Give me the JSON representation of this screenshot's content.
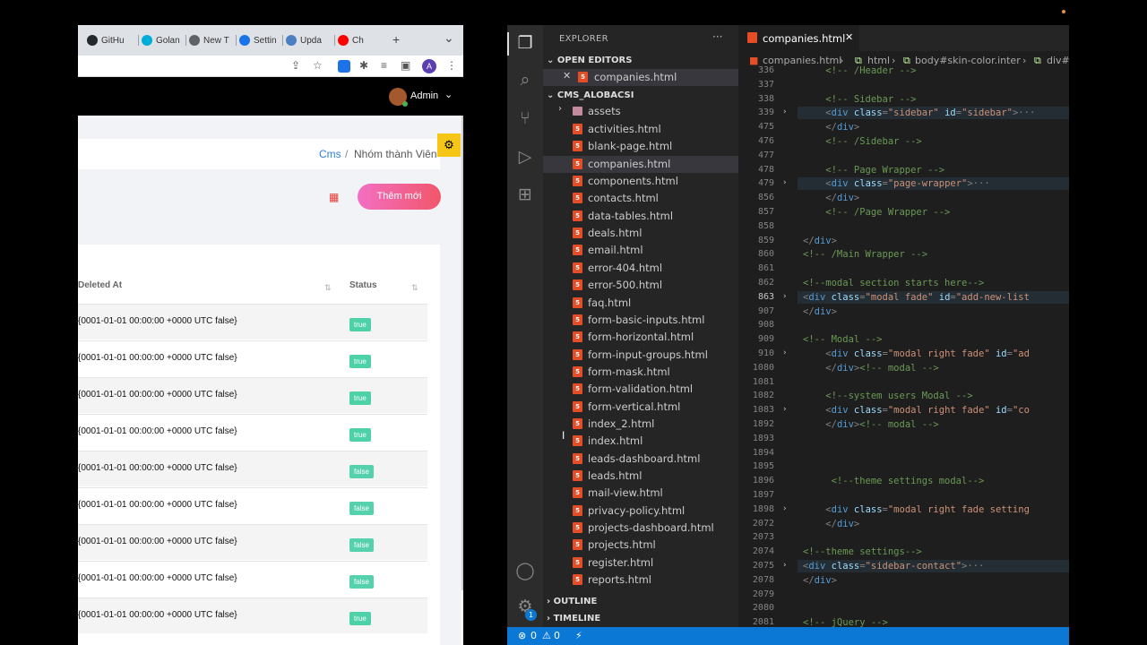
{
  "browser": {
    "tabs": [
      {
        "label": "GitHu",
        "color": "#24292e"
      },
      {
        "label": "Golan",
        "color": "#00add8"
      },
      {
        "label": "New T",
        "color": "#5f6368"
      },
      {
        "label": "Settin",
        "color": "#1a73e8"
      },
      {
        "label": "Upda",
        "color": "#4a7fc1"
      },
      {
        "label": "Ch",
        "color": "#ff0000"
      }
    ],
    "new_tab": "+",
    "tab_menu": "⌄",
    "profile_initial": "A"
  },
  "app": {
    "user_name": "Admin",
    "breadcrumb": {
      "root": "Cms",
      "sep": "/",
      "current": "Nhóm thành Viên"
    },
    "add_button": "Thêm mới",
    "columns": {
      "deleted_at": "Deleted At",
      "status": "Status"
    },
    "rows": [
      {
        "deleted_at": "{0001-01-01 00:00:00 +0000 UTC false}",
        "status": "true"
      },
      {
        "deleted_at": "{0001-01-01 00:00:00 +0000 UTC false}",
        "status": "true"
      },
      {
        "deleted_at": "{0001-01-01 00:00:00 +0000 UTC false}",
        "status": "true"
      },
      {
        "deleted_at": "{0001-01-01 00:00:00 +0000 UTC false}",
        "status": "true"
      },
      {
        "deleted_at": "{0001-01-01 00:00:00 +0000 UTC false}",
        "status": "false"
      },
      {
        "deleted_at": "{0001-01-01 00:00:00 +0000 UTC false}",
        "status": "false"
      },
      {
        "deleted_at": "{0001-01-01 00:00:00 +0000 UTC false}",
        "status": "false"
      },
      {
        "deleted_at": "{0001-01-01 00:00:00 +0000 UTC false}",
        "status": "false"
      },
      {
        "deleted_at": "{0001-01-01 00:00:00 +0000 UTC false}",
        "status": "true"
      }
    ]
  },
  "vscode": {
    "explorer_title": "EXPLORER",
    "explorer_more": "···",
    "open_editors": "OPEN EDITORS",
    "open_file": "companies.html",
    "project": "CMS_ALOBACSI",
    "folder": "assets",
    "files": [
      "activities.html",
      "blank-page.html",
      "companies.html",
      "components.html",
      "contacts.html",
      "data-tables.html",
      "deals.html",
      "email.html",
      "error-404.html",
      "error-500.html",
      "faq.html",
      "form-basic-inputs.html",
      "form-horizontal.html",
      "form-input-groups.html",
      "form-mask.html",
      "form-validation.html",
      "form-vertical.html",
      "index_2.html",
      "index.html",
      "leads-dashboard.html",
      "leads.html",
      "mail-view.html",
      "privacy-policy.html",
      "projects-dashboard.html",
      "projects.html",
      "register.html",
      "reports.html"
    ],
    "selected_file": "companies.html",
    "outline": "OUTLINE",
    "timeline": "TIMELINE",
    "active_tab": "companies.html",
    "breadcrumbs": [
      "companies.html",
      "html",
      "body#skin-color.inter",
      "div#"
    ],
    "accounts_badge": "1",
    "status": {
      "errors": "0",
      "warnings": "0"
    },
    "lines": [
      {
        "n": "336",
        "fold": false,
        "hl": false,
        "html": "<span class='c-cm'>    &lt;!-- /Header --&gt;</span>"
      },
      {
        "n": "337",
        "fold": false,
        "hl": false,
        "html": ""
      },
      {
        "n": "338",
        "fold": false,
        "hl": false,
        "html": "<span class='c-cm'>    &lt;!-- Sidebar --&gt;</span>"
      },
      {
        "n": "339",
        "fold": true,
        "hl": true,
        "html": "    <span class='c-pl'>&lt;</span><span class='c-tag'>div</span> <span class='c-at'>class</span>=<span class='c-st'>\"sidebar\"</span> <span class='c-at'>id</span>=<span class='c-st'>\"sidebar\"</span><span class='c-pl'>&gt;···</span>"
      },
      {
        "n": "475",
        "fold": false,
        "hl": false,
        "html": "    <span class='c-pl'>&lt;/</span><span class='c-tag'>div</span><span class='c-pl'>&gt;</span>"
      },
      {
        "n": "476",
        "fold": false,
        "hl": false,
        "html": "<span class='c-cm'>    &lt;!-- /Sidebar --&gt;</span>"
      },
      {
        "n": "477",
        "fold": false,
        "hl": false,
        "html": ""
      },
      {
        "n": "478",
        "fold": false,
        "hl": false,
        "html": "<span class='c-cm'>    &lt;!-- Page Wrapper --&gt;</span>"
      },
      {
        "n": "479",
        "fold": true,
        "hl": true,
        "html": "    <span class='c-pl'>&lt;</span><span class='c-tag'>div</span> <span class='c-at'>class</span>=<span class='c-st'>\"page-wrapper\"</span><span class='c-pl'>&gt;···</span>"
      },
      {
        "n": "856",
        "fold": false,
        "hl": false,
        "html": "    <span class='c-pl'>&lt;/</span><span class='c-tag'>div</span><span class='c-pl'>&gt;</span>"
      },
      {
        "n": "857",
        "fold": false,
        "hl": false,
        "html": "<span class='c-cm'>    &lt;!-- /Page Wrapper --&gt;</span>"
      },
      {
        "n": "858",
        "fold": false,
        "hl": false,
        "html": ""
      },
      {
        "n": "859",
        "fold": false,
        "hl": false,
        "html": "<span class='c-pl'>&lt;/</span><span class='c-tag'>div</span><span class='c-pl'>&gt;</span>"
      },
      {
        "n": "860",
        "fold": false,
        "hl": false,
        "html": "<span class='c-cm'>&lt;!-- /Main Wrapper --&gt;</span>"
      },
      {
        "n": "861",
        "fold": false,
        "hl": false,
        "html": ""
      },
      {
        "n": "862",
        "fold": false,
        "hl": false,
        "html": "<span class='c-cm'>&lt;!--modal section starts here--&gt;</span>"
      },
      {
        "n": "863",
        "fold": true,
        "hl": true,
        "cur": true,
        "html": "<span class='c-pl'>&lt;</span><span class='c-tag'>div</span> <span class='c-at'>class</span>=<span class='c-st'>\"modal fade\"</span> <span class='c-at'>id</span>=<span class='c-st'>\"add-new-list</span>"
      },
      {
        "n": "907",
        "fold": false,
        "hl": false,
        "html": "<span class='c-pl'>&lt;/</span><span class='c-tag'>div</span><span class='c-pl'>&gt;</span>"
      },
      {
        "n": "908",
        "fold": false,
        "hl": false,
        "html": ""
      },
      {
        "n": "909",
        "fold": false,
        "hl": false,
        "html": "<span class='c-cm'>&lt;!-- Modal --&gt;</span>"
      },
      {
        "n": "910",
        "fold": true,
        "hl": false,
        "html": "    <span class='c-pl'>&lt;</span><span class='c-tag'>div</span> <span class='c-at'>class</span>=<span class='c-st'>\"modal right fade\"</span> <span class='c-at'>id</span>=<span class='c-st'>\"ad</span>"
      },
      {
        "n": "1080",
        "fold": false,
        "hl": false,
        "html": "    <span class='c-pl'>&lt;/</span><span class='c-tag'>div</span><span class='c-pl'>&gt;</span><span class='c-cm'>&lt;!-- modal --&gt;</span>"
      },
      {
        "n": "1081",
        "fold": false,
        "hl": false,
        "html": ""
      },
      {
        "n": "1082",
        "fold": false,
        "hl": false,
        "html": "<span class='c-cm'>    &lt;!--system users Modal --&gt;</span>"
      },
      {
        "n": "1083",
        "fold": true,
        "hl": false,
        "html": "    <span class='c-pl'>&lt;</span><span class='c-tag'>div</span> <span class='c-at'>class</span>=<span class='c-st'>\"modal right fade\"</span> <span class='c-at'>id</span>=<span class='c-st'>\"co</span>"
      },
      {
        "n": "1892",
        "fold": false,
        "hl": false,
        "html": "    <span class='c-pl'>&lt;/</span><span class='c-tag'>div</span><span class='c-pl'>&gt;</span><span class='c-cm'>&lt;!-- modal --&gt;</span>"
      },
      {
        "n": "1893",
        "fold": false,
        "hl": false,
        "html": ""
      },
      {
        "n": "1894",
        "fold": false,
        "hl": false,
        "html": ""
      },
      {
        "n": "1895",
        "fold": false,
        "hl": false,
        "html": ""
      },
      {
        "n": "1896",
        "fold": false,
        "hl": false,
        "html": "<span class='c-cm'>     &lt;!--theme settings modal--&gt;</span>"
      },
      {
        "n": "1897",
        "fold": false,
        "hl": false,
        "html": ""
      },
      {
        "n": "1898",
        "fold": true,
        "hl": false,
        "html": "    <span class='c-pl'>&lt;</span><span class='c-tag'>div</span> <span class='c-at'>class</span>=<span class='c-st'>\"modal right fade setting</span>"
      },
      {
        "n": "2072",
        "fold": false,
        "hl": false,
        "html": "    <span class='c-pl'>&lt;/</span><span class='c-tag'>div</span><span class='c-pl'>&gt;</span>"
      },
      {
        "n": "2073",
        "fold": false,
        "hl": false,
        "html": ""
      },
      {
        "n": "2074",
        "fold": false,
        "hl": false,
        "html": "<span class='c-cm'>&lt;!--theme settings--&gt;</span>"
      },
      {
        "n": "2075",
        "fold": true,
        "hl": true,
        "html": "<span class='c-pl'>&lt;</span><span class='c-tag'>div</span> <span class='c-at'>class</span>=<span class='c-st'>\"sidebar-contact\"</span><span class='c-pl'>&gt;···</span>"
      },
      {
        "n": "2078",
        "fold": false,
        "hl": false,
        "html": "<span class='c-pl'>&lt;/</span><span class='c-tag'>div</span><span class='c-pl'>&gt;</span>"
      },
      {
        "n": "2079",
        "fold": false,
        "hl": false,
        "html": ""
      },
      {
        "n": "2080",
        "fold": false,
        "hl": false,
        "html": ""
      },
      {
        "n": "2081",
        "fold": false,
        "hl": false,
        "html": "<span class='c-cm'>&lt;!-- jQuery --&gt;</span>"
      }
    ]
  },
  "colors": {
    "accent_gradient_start": "#f36fc3",
    "accent_gradient_end": "#f2566a",
    "status_true": "#4cd2a6",
    "vscode_statusbar": "#0a78d4"
  }
}
